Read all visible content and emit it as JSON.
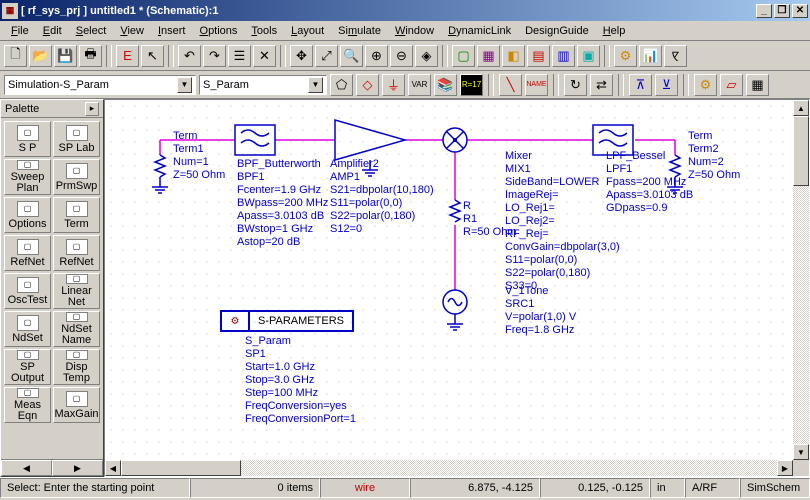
{
  "window": {
    "title": "[ rf_sys_prj ] untitled1 * (Schematic):1"
  },
  "menu": [
    "File",
    "Edit",
    "Select",
    "View",
    "Insert",
    "Options",
    "Tools",
    "Layout",
    "Simulate",
    "Window",
    "DynamicLink",
    "DesignGuide",
    "Help"
  ],
  "param": {
    "category": "Simulation-S_Param",
    "component": "S_Param"
  },
  "palette": {
    "title": "Palette",
    "items": [
      {
        "label": "S P"
      },
      {
        "label": "SP Lab"
      },
      {
        "label": "Sweep\nPlan"
      },
      {
        "label": "PrmSwp"
      },
      {
        "label": "Options"
      },
      {
        "label": "Term"
      },
      {
        "label": "RefNet"
      },
      {
        "label": "RefNet"
      },
      {
        "label": "OscTest"
      },
      {
        "label": "Linear\nNet"
      },
      {
        "label": "NdSet"
      },
      {
        "label": "NdSet\nName"
      },
      {
        "label": "SP\nOutput"
      },
      {
        "label": "Disp\nTemp"
      },
      {
        "label": "Meas\nEqn"
      },
      {
        "label": "MaxGain"
      }
    ]
  },
  "components": {
    "term1": {
      "name": "Term",
      "inst": "Term1",
      "p1": "Num=1",
      "p2": "Z=50 Ohm"
    },
    "bpf": {
      "name": "BPF_Butterworth",
      "inst": "BPF1",
      "p1": "Fcenter=1.9 GHz",
      "p2": "BWpass=200 MHz",
      "p3": "Apass=3.0103 dB",
      "p4": "BWstop=1 GHz",
      "p5": "Astop=20 dB"
    },
    "amp": {
      "name": "Amplifier2",
      "inst": "AMP1",
      "p1": "S21=dbpolar(10,180)",
      "p2": "S11=polar(0,0)",
      "p3": "S22=polar(0,180)",
      "p4": "S12=0"
    },
    "res": {
      "name": "R",
      "inst": "R1",
      "p1": "R=50 Ohm"
    },
    "mix": {
      "name": "Mixer",
      "inst": "MIX1",
      "p1": "SideBand=LOWER",
      "p2": "ImageRej=",
      "p3": "LO_Rej1=",
      "p4": "LO_Rej2=",
      "p5": "RF_Rej=",
      "p6": "ConvGain=dbpolar(3,0)",
      "p7": "S11=polar(0,0)",
      "p8": "S22=polar(0,180)",
      "p9": "S33=0"
    },
    "lpf": {
      "name": "LPF_Bessel",
      "inst": "LPF1",
      "p1": "Fpass=200 MHz",
      "p2": "Apass=3.0103 dB",
      "p3": "GDpass=0.9"
    },
    "term2": {
      "name": "Term",
      "inst": "Term2",
      "p1": "Num=2",
      "p2": "Z=50 Ohm"
    },
    "src": {
      "name": "V_1Tone",
      "inst": "SRC1",
      "p1": "V=polar(1,0) V",
      "p2": "Freq=1.8 GHz"
    },
    "sparam": {
      "box": "S-PARAMETERS",
      "name": "S_Param",
      "inst": "SP1",
      "p1": "Start=1.0 GHz",
      "p2": "Stop=3.0 GHz",
      "p3": "Step=100 MHz",
      "p4": "FreqConversion=yes",
      "p5": "FreqConversionPort=1"
    }
  },
  "status": {
    "hint": "Select: Enter the starting point",
    "items": "0 items",
    "wire": "wire",
    "coord1": "6.875, -4.125",
    "coord2": "0.125, -0.125",
    "units": "in",
    "layer": "A/RF",
    "mode": "SimSchem"
  }
}
